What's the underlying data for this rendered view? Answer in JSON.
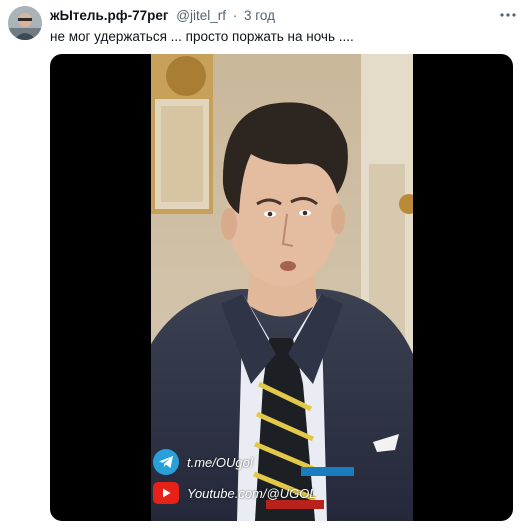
{
  "tweet": {
    "author_name": "жЫтель.рф-77рег",
    "handle": "@jitel_rf",
    "separator": "·",
    "time": "3 год",
    "text": "не мог удержаться ... просто поржать на ночь ...."
  },
  "media": {
    "watermark_telegram": "t.me/OUgol",
    "watermark_youtube": "Youtube.com/@UGOL",
    "icons": [
      "telegram-icon",
      "youtube-icon",
      "more-options-icon"
    ]
  },
  "colors": {
    "text": "#0f1419",
    "secondary": "#536471",
    "telegram": "#2aa0da",
    "youtube": "#e62117"
  }
}
